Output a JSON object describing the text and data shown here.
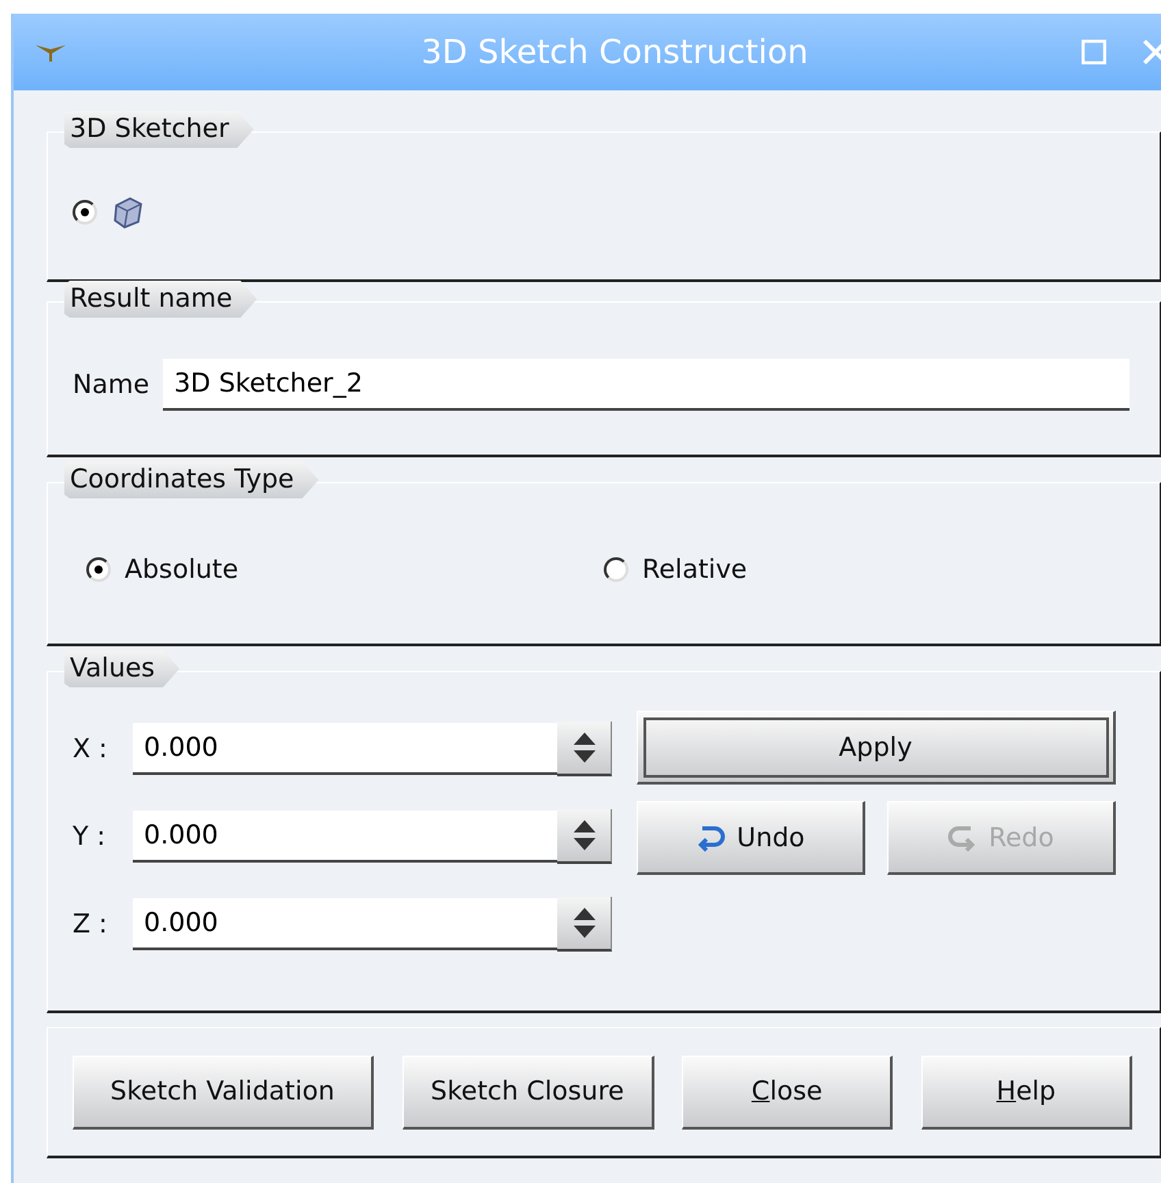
{
  "window": {
    "title": "3D Sketch Construction"
  },
  "sketcher_group": {
    "title": "3D Sketcher",
    "options": [
      {
        "selected": true
      }
    ]
  },
  "result_group": {
    "title": "Result name",
    "name_label": "Name",
    "name_value": "3D Sketcher_2"
  },
  "coordinates_group": {
    "title": "Coordinates Type",
    "options": [
      {
        "label": "Absolute",
        "selected": true
      },
      {
        "label": "Relative",
        "selected": false
      }
    ]
  },
  "values_group": {
    "title": "Values",
    "fields": [
      {
        "label": "X :",
        "value": "0.000"
      },
      {
        "label": "Y :",
        "value": "0.000"
      },
      {
        "label": "Z :",
        "value": "0.000"
      }
    ],
    "apply": {
      "label": "Apply",
      "disabled": false
    },
    "undo": {
      "label": "Undo",
      "disabled": false
    },
    "redo": {
      "label": "Redo",
      "disabled": true
    }
  },
  "buttons": [
    {
      "label": "Sketch Validation",
      "mnemonic": false
    },
    {
      "label": "Sketch Closure",
      "mnemonic": false
    },
    {
      "label": "Close",
      "mnemonic": true
    },
    {
      "label": "Help",
      "mnemonic": true
    }
  ]
}
